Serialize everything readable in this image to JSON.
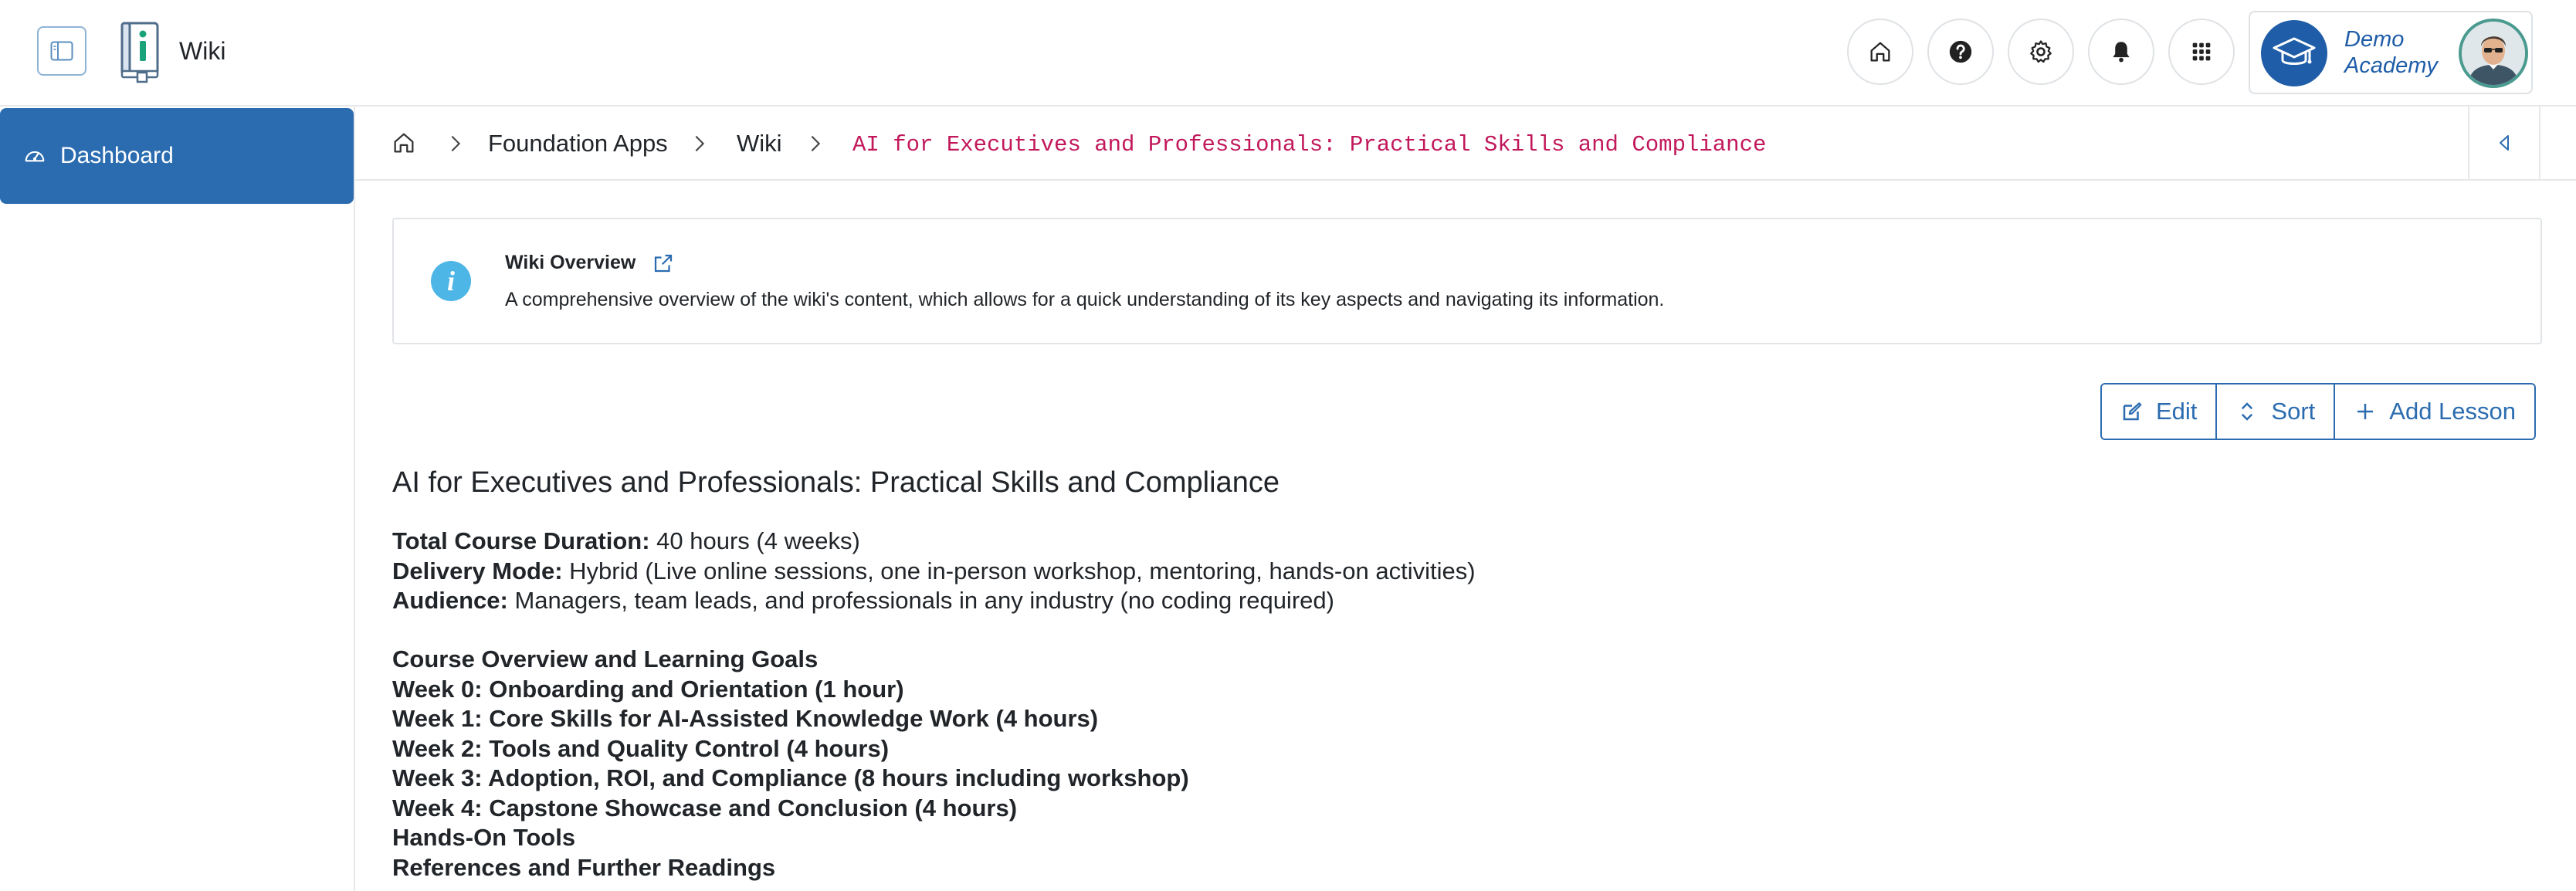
{
  "app": {
    "title": "Wiki"
  },
  "header": {
    "buttons": [
      {
        "name": "home-button",
        "icon": "home-icon"
      },
      {
        "name": "help-button",
        "icon": "help-icon"
      },
      {
        "name": "settings-button",
        "icon": "gear-icon"
      },
      {
        "name": "notifications-button",
        "icon": "bell-icon"
      },
      {
        "name": "apps-button",
        "icon": "grid-icon"
      }
    ],
    "org": {
      "name": "Demo Academy",
      "logo_icon": "graduation-cap-icon",
      "brand_color": "#1f5da8"
    }
  },
  "sidebar": {
    "items": [
      {
        "label": "Dashboard",
        "icon": "dashboard-gauge-icon",
        "active": true
      }
    ],
    "active_color": "#2b6cb0"
  },
  "breadcrumb": {
    "home_icon": "home-icon",
    "items": [
      {
        "label": "Foundation Apps"
      },
      {
        "label": "Wiki"
      },
      {
        "label": "AI for Executives and Professionals: Practical Skills and Compliance"
      }
    ],
    "current_color": "#c2185b"
  },
  "info": {
    "title": "Wiki Overview",
    "description": "A comprehensive overview of the wiki's content, which allows for a quick understanding of its key aspects and navigating its information."
  },
  "actions": {
    "edit_label": "Edit",
    "sort_label": "Sort",
    "add_label": "Add Lesson"
  },
  "content": {
    "title": "AI for Executives and Professionals: Practical Skills and Compliance",
    "meta": [
      {
        "label": "Total Course Duration:",
        "value": " 40 hours (4 weeks)"
      },
      {
        "label": "Delivery Mode:",
        "value": " Hybrid (Live online sessions, one in-person workshop, mentoring, hands-on activities)"
      },
      {
        "label": "Audience:",
        "value": " Managers, team leads, and professionals in any industry (no coding required)"
      }
    ],
    "outline": [
      "Course Overview and Learning Goals",
      "Week 0: Onboarding and Orientation (1 hour)",
      "Week 1: Core Skills for AI-Assisted Knowledge Work (4 hours)",
      "Week 2: Tools and Quality Control (4 hours)",
      "Week 3: Adoption, ROI, and Compliance (8 hours including workshop)",
      "Week 4: Capstone Showcase and Conclusion (4 hours)",
      "Hands-On Tools",
      "References and Further Readings"
    ]
  }
}
